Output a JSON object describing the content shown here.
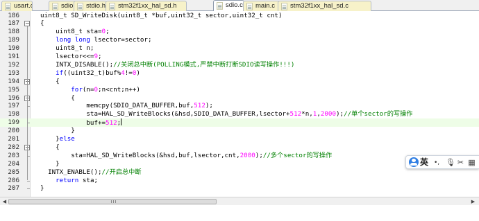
{
  "tabs": [
    {
      "label": "usart.c",
      "active": false
    },
    {
      "label": "sdio.h",
      "active": false
    },
    {
      "label": "stdio.h",
      "active": false
    },
    {
      "label": "stm32f1xx_hal_sd.h",
      "active": false
    },
    {
      "label": "sdio.c",
      "active": true
    },
    {
      "label": "main.c",
      "active": false
    },
    {
      "label": "stm32f1xx_hal_sd.c",
      "active": false
    }
  ],
  "editor": {
    "current_line": 199,
    "lines": [
      {
        "num": "186",
        "text": "uint8_t SD_WriteDisk(uint8_t *buf,uint32_t sector,uint32_t cnt)"
      },
      {
        "num": "187",
        "text": "{"
      },
      {
        "num": "188",
        "text": "    uint8_t sta=0;"
      },
      {
        "num": "189",
        "text": "    long long lsector=sector;"
      },
      {
        "num": "190",
        "text": "    uint8_t n;"
      },
      {
        "num": "191",
        "text": "    lsector<<=9;"
      },
      {
        "num": "192",
        "text": "    INTX_DISABLE();//关闭总中断(POLLING模式,严禁中断打断SDIO读写操作!!!)"
      },
      {
        "num": "193",
        "text": "    if((uint32_t)buf%4!=0)"
      },
      {
        "num": "194",
        "text": "    {"
      },
      {
        "num": "195",
        "text": "        for(n=0;n<cnt;n++)"
      },
      {
        "num": "196",
        "text": "        {"
      },
      {
        "num": "197",
        "text": "            memcpy(SDIO_DATA_BUFFER,buf,512);"
      },
      {
        "num": "198",
        "text": "            sta=HAL_SD_WriteBlocks(&hsd,SDIO_DATA_BUFFER,lsector+512*n,1,2000);//单个sector的写操作"
      },
      {
        "num": "199",
        "text": "            buf+=512;"
      },
      {
        "num": "200",
        "text": "        }"
      },
      {
        "num": "201",
        "text": "    }else"
      },
      {
        "num": "202",
        "text": "    {"
      },
      {
        "num": "203",
        "text": "        sta=HAL_SD_WriteBlocks(&hsd,buf,lsector,cnt,2000);//多个sector的写操作"
      },
      {
        "num": "204",
        "text": "    }"
      },
      {
        "num": "205",
        "text": "  INTX_ENABLE();//开启总中断"
      },
      {
        "num": "206",
        "text": "    return sta;"
      },
      {
        "num": "207",
        "text": "}"
      }
    ]
  },
  "ime": {
    "language": "英",
    "separator": "•,",
    "icons": [
      "microphone-icon",
      "scissors-icon",
      "grid-menu-icon"
    ]
  },
  "colors": {
    "keyword": "#0000ff",
    "comment": "#008000",
    "number": "#ff00ff",
    "current_line_bg": "#eefde7",
    "tab_inactive_bg": "#f7f2c9",
    "ime_accent": "#2f7ee3"
  }
}
